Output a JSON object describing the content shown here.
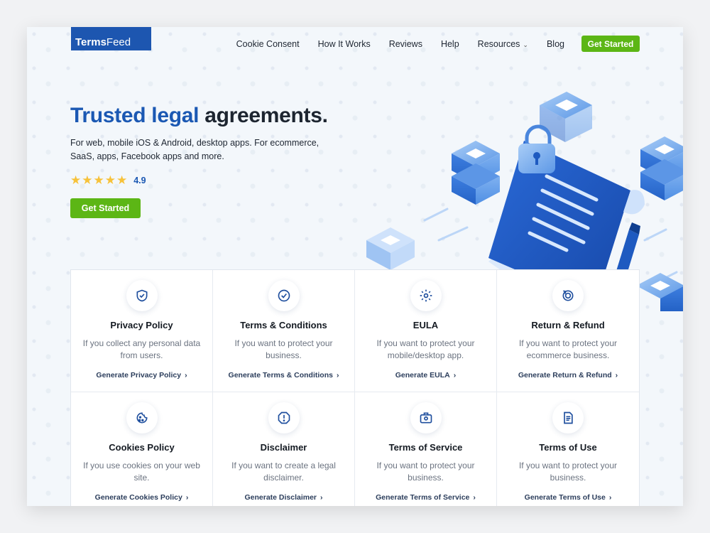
{
  "header": {
    "logo_bold": "Terms",
    "logo_light": "Feed",
    "nav": [
      "Cookie Consent",
      "How It Works",
      "Reviews",
      "Help",
      "Resources",
      "Blog"
    ],
    "cta": "Get Started"
  },
  "hero": {
    "title_blue": "Trusted legal",
    "title_dark": "agreements.",
    "subtitle": "For web, mobile iOS & Android, desktop apps. For ecommerce, SaaS, apps, Facebook apps and more.",
    "stars": "★★★★★",
    "rating": "4.9",
    "cta": "Get Started"
  },
  "cards": [
    {
      "title": "Privacy Policy",
      "desc": "If you collect any personal data from users.",
      "link": "Generate Privacy Policy",
      "icon": "shield-check-icon"
    },
    {
      "title": "Terms & Conditions",
      "desc": "If you want to protect your business.",
      "link": "Generate Terms & Conditions",
      "icon": "checkmark-circle-icon"
    },
    {
      "title": "EULA",
      "desc": "If you want to protect your mobile/desktop app.",
      "link": "Generate EULA",
      "icon": "gear-icon"
    },
    {
      "title": "Return & Refund",
      "desc": "If you want to protect your ecommerce business.",
      "link": "Generate Return & Refund",
      "icon": "refund-icon"
    },
    {
      "title": "Cookies Policy",
      "desc": "If you use cookies on your web site.",
      "link": "Generate Cookies Policy",
      "icon": "cookie-icon"
    },
    {
      "title": "Disclaimer",
      "desc": "If you want to create a legal disclaimer.",
      "link": "Generate Disclaimer",
      "icon": "alert-octagon-icon"
    },
    {
      "title": "Terms of Service",
      "desc": "If you want to protect your business.",
      "link": "Generate Terms of Service",
      "icon": "briefcase-icon"
    },
    {
      "title": "Terms of Use",
      "desc": "If you want to protect your business.",
      "link": "Generate Terms of Use",
      "icon": "document-icon"
    }
  ],
  "colors": {
    "brand_blue": "#1b58b3",
    "cta_green": "#5cb615",
    "star": "#f7c23a"
  }
}
